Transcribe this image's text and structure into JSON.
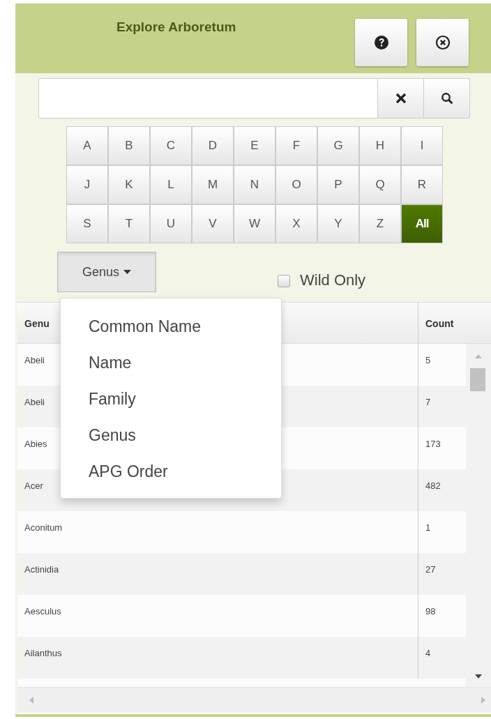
{
  "header": {
    "title": "Explore Arboretum"
  },
  "letters": [
    {
      "label": "A",
      "selected": false
    },
    {
      "label": "B",
      "selected": false
    },
    {
      "label": "C",
      "selected": false
    },
    {
      "label": "D",
      "selected": false
    },
    {
      "label": "E",
      "selected": false
    },
    {
      "label": "F",
      "selected": false
    },
    {
      "label": "G",
      "selected": false
    },
    {
      "label": "H",
      "selected": false
    },
    {
      "label": "I",
      "selected": false
    },
    {
      "label": "J",
      "selected": false
    },
    {
      "label": "K",
      "selected": false
    },
    {
      "label": "L",
      "selected": false
    },
    {
      "label": "M",
      "selected": false
    },
    {
      "label": "N",
      "selected": false
    },
    {
      "label": "O",
      "selected": false
    },
    {
      "label": "P",
      "selected": false
    },
    {
      "label": "Q",
      "selected": false
    },
    {
      "label": "R",
      "selected": false
    },
    {
      "label": "S",
      "selected": false
    },
    {
      "label": "T",
      "selected": false
    },
    {
      "label": "U",
      "selected": false
    },
    {
      "label": "V",
      "selected": false
    },
    {
      "label": "W",
      "selected": false
    },
    {
      "label": "X",
      "selected": false
    },
    {
      "label": "Y",
      "selected": false
    },
    {
      "label": "Z",
      "selected": false
    },
    {
      "label": "All",
      "selected": true
    }
  ],
  "group_by": {
    "label": "Genus",
    "expanded": true,
    "options": [
      "Common Name",
      "Name",
      "Family",
      "Genus",
      "APG Order"
    ]
  },
  "wild_only": {
    "label": "Wild Only",
    "checked": false
  },
  "table": {
    "columns": [
      "Genu",
      "Count"
    ],
    "rows": [
      {
        "name": "Abeli",
        "count": "5"
      },
      {
        "name": "Abeli",
        "count": "7"
      },
      {
        "name": "Abies",
        "count": "173"
      },
      {
        "name": "Acer",
        "count": "482"
      },
      {
        "name": "Aconitum",
        "count": "1"
      },
      {
        "name": "Actinidia",
        "count": "27"
      },
      {
        "name": "Aesculus",
        "count": "98"
      },
      {
        "name": "Ailanthus",
        "count": "4"
      }
    ]
  }
}
